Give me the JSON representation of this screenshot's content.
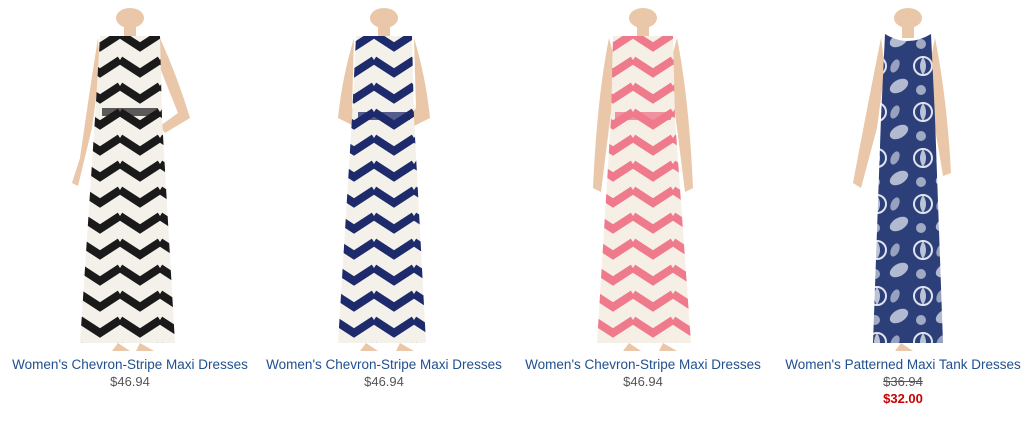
{
  "products": [
    {
      "name": "Women's Chevron-Stripe Maxi Dresses",
      "price": "$46.94",
      "sale_price": null,
      "colors": {
        "stripe": "#1a1a1a",
        "base": "#f4f1ea"
      }
    },
    {
      "name": "Women's Chevron-Stripe Maxi Dresses",
      "price": "$46.94",
      "sale_price": null,
      "colors": {
        "stripe": "#1d2a6b",
        "base": "#f4f1ea"
      }
    },
    {
      "name": "Women's Chevron-Stripe Maxi Dresses",
      "price": "$46.94",
      "sale_price": null,
      "colors": {
        "stripe": "#ee7a8c",
        "base": "#f6efe6"
      }
    },
    {
      "name": "Women's Patterned Maxi Tank Dresses",
      "price": "$36.94",
      "sale_price": "$32.00",
      "colors": {
        "stripe": "#2c3f78",
        "base": "#dfe3ee"
      }
    }
  ],
  "styles": {
    "link_color": "#1f4f8f",
    "price_color": "#555555",
    "sale_color": "#cc0000",
    "skin_color": "#e9c7a8"
  }
}
